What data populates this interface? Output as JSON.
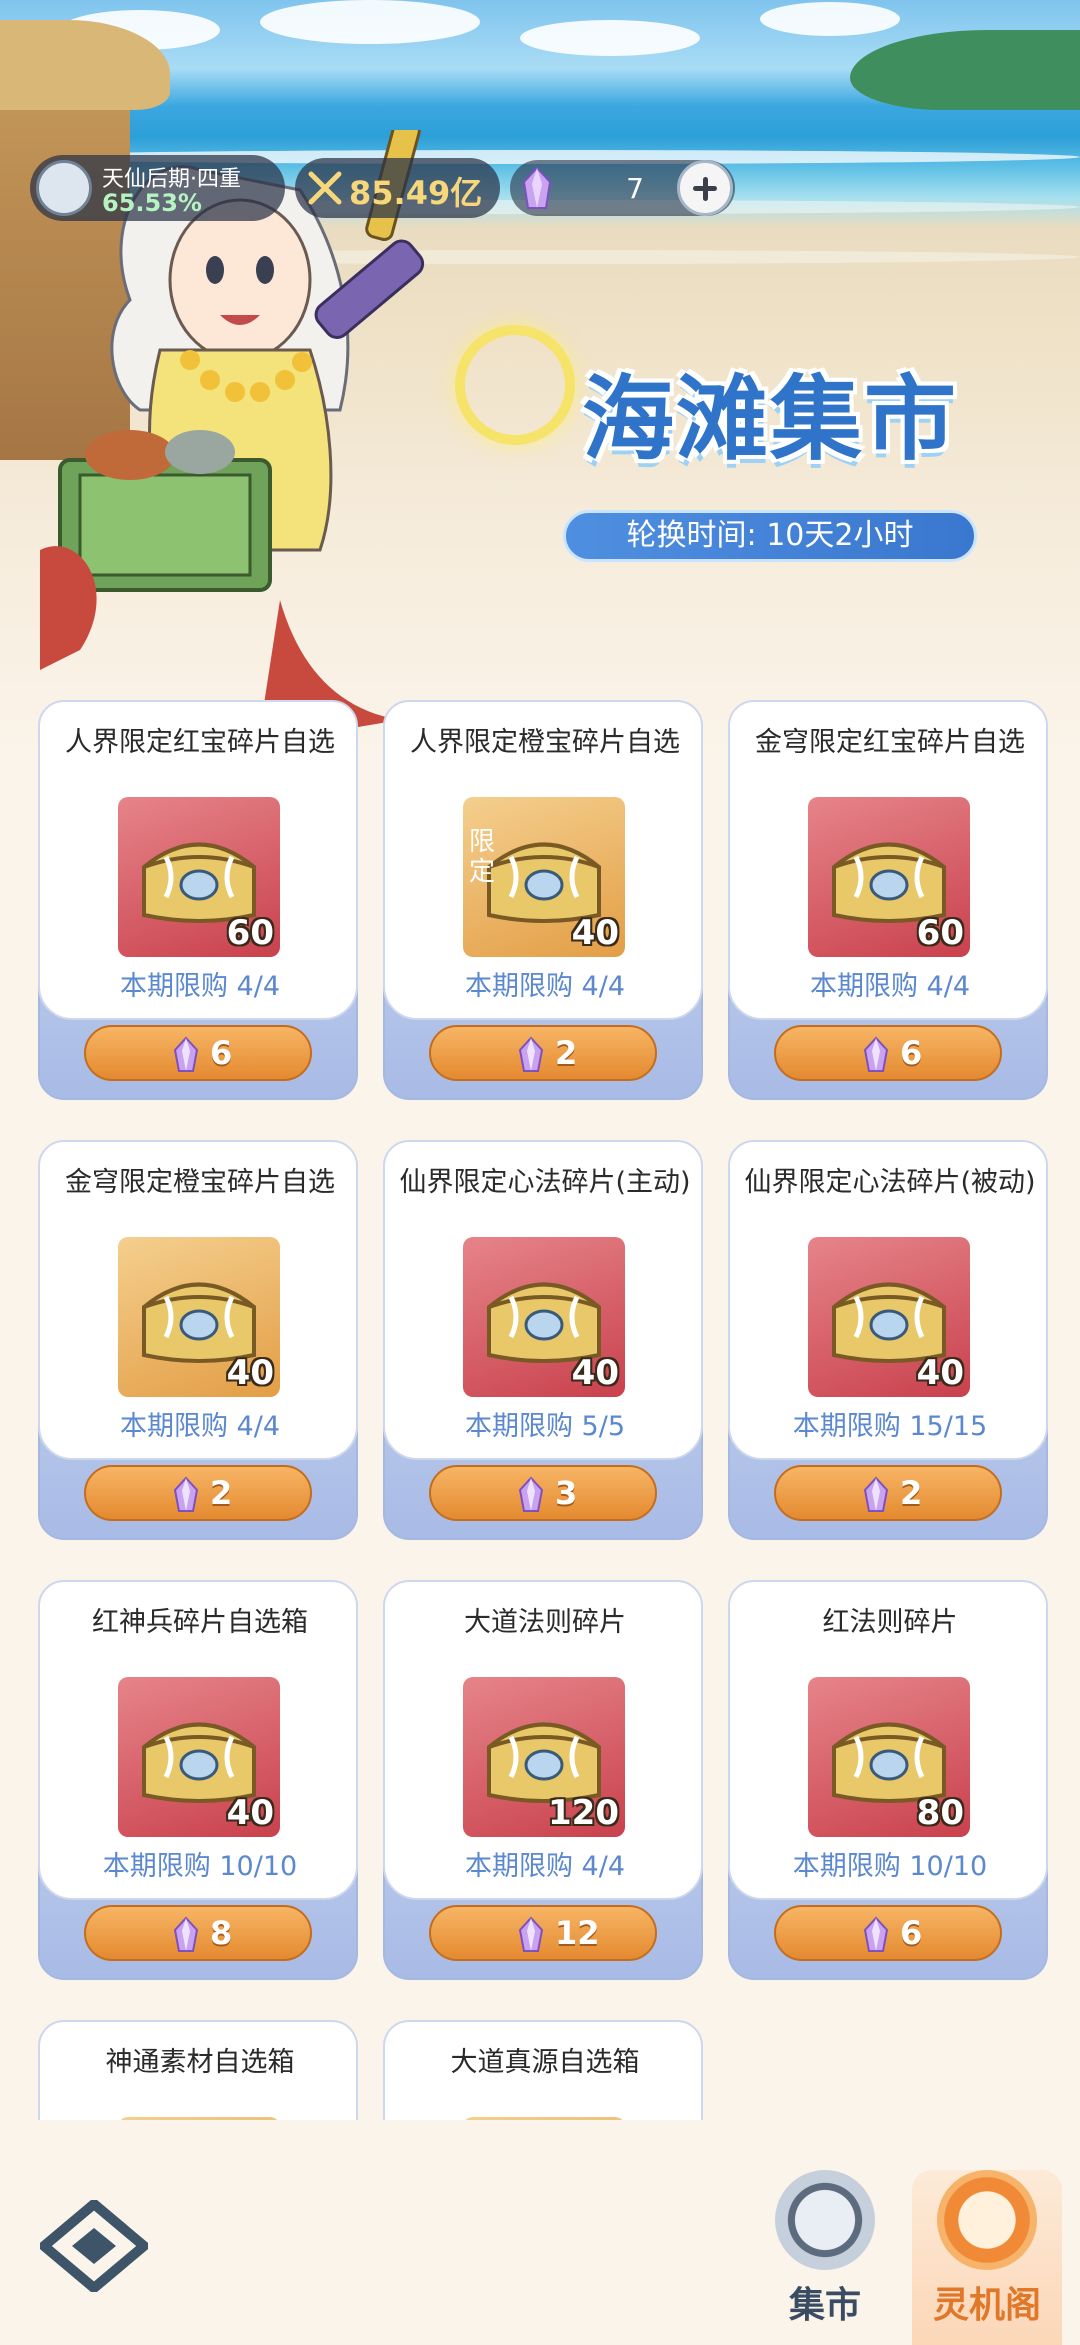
{
  "header": {
    "realm_name": "天仙后期·四重",
    "realm_progress": "65.53%",
    "combat_power": "85.49亿",
    "gem_count": "7",
    "title": "海滩集市",
    "rotation_label": "轮换时间:",
    "rotation_time": "10天2小时"
  },
  "items": [
    {
      "name": "人界限定红宝碎片自选",
      "qty": "60",
      "limit": "本期限购 4/4",
      "price": "6",
      "bg": "red"
    },
    {
      "name": "人界限定橙宝碎片自选",
      "qty": "40",
      "limit": "本期限购 4/4",
      "price": "2",
      "bg": "orange",
      "tag": "限定"
    },
    {
      "name": "金穹限定红宝碎片自选",
      "qty": "60",
      "limit": "本期限购 4/4",
      "price": "6",
      "bg": "red"
    },
    {
      "name": "金穹限定橙宝碎片自选",
      "qty": "40",
      "limit": "本期限购 4/4",
      "price": "2",
      "bg": "orange"
    },
    {
      "name": "仙界限定心法碎片(主动)",
      "qty": "40",
      "limit": "本期限购 5/5",
      "price": "3",
      "bg": "red"
    },
    {
      "name": "仙界限定心法碎片(被动)",
      "qty": "40",
      "limit": "本期限购 15/15",
      "price": "2",
      "bg": "red"
    },
    {
      "name": "红神兵碎片自选箱",
      "qty": "40",
      "limit": "本期限购 10/10",
      "price": "8",
      "bg": "red"
    },
    {
      "name": "大道法则碎片",
      "qty": "120",
      "limit": "本期限购 4/4",
      "price": "12",
      "bg": "red"
    },
    {
      "name": "红法则碎片",
      "qty": "80",
      "limit": "本期限购 10/10",
      "price": "6",
      "bg": "red"
    },
    {
      "name": "神通素材自选箱",
      "qty": "",
      "limit": "",
      "price": "",
      "bg": "orange"
    },
    {
      "name": "大道真源自选箱",
      "qty": "",
      "limit": "",
      "price": "",
      "bg": "orange"
    }
  ],
  "nav": {
    "market_label": "集市",
    "pavilion_label": "灵机阁"
  },
  "colors": {
    "accent": "#e48a31",
    "limit_text": "#5b88cf",
    "title_blue": "#2f74c9"
  },
  "icons": {
    "currency": "purple-crystal-icon",
    "power": "crossed-swords-icon",
    "menu": "diamond-menu-icon"
  }
}
